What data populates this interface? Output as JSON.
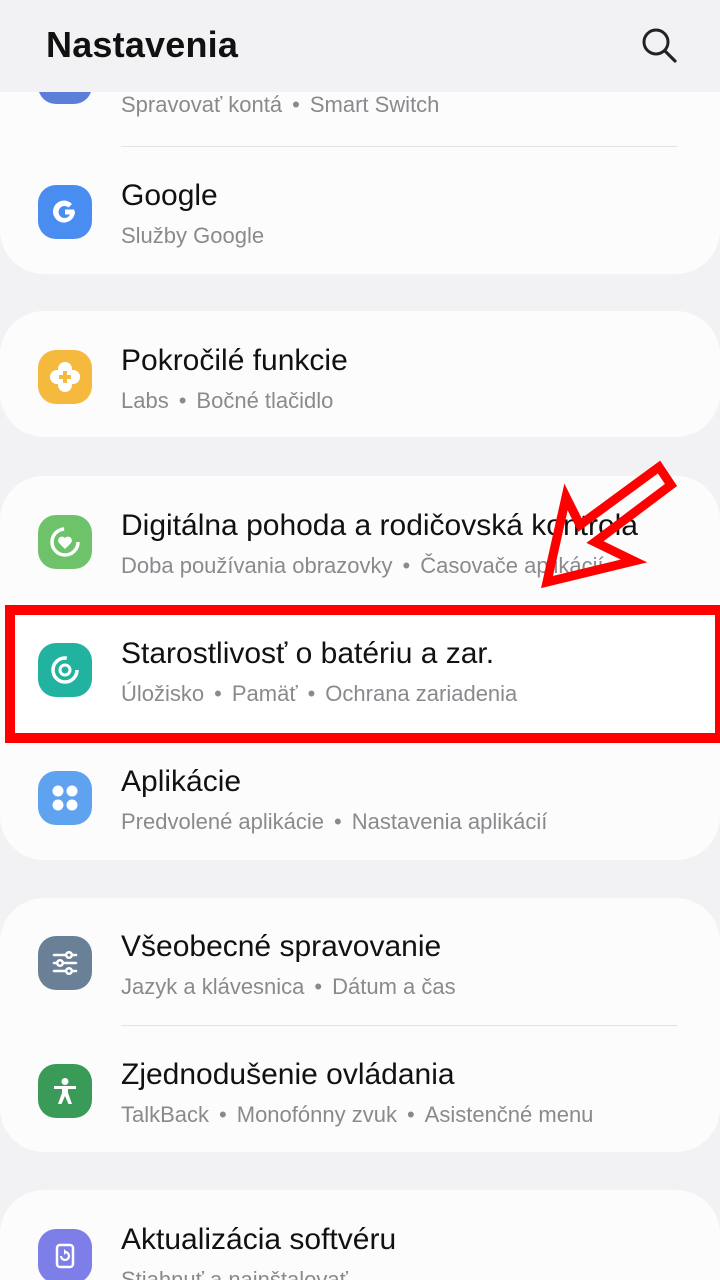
{
  "header": {
    "title": "Nastavenia",
    "search_icon": "search-icon"
  },
  "top_partial": {
    "sub": [
      "Spravovať kontá",
      "Smart Switch"
    ]
  },
  "items": {
    "google": {
      "title": "Google",
      "sub": [
        "Služby Google"
      ],
      "color": "#4a8df0",
      "icon": "google-icon"
    },
    "advanced": {
      "title": "Pokročilé funkcie",
      "sub": [
        "Labs",
        "Bočné tlačidlo"
      ],
      "color": "#f5b93d",
      "icon": "puzzle-icon"
    },
    "wellbeing": {
      "title": "Digitálna pohoda a rodičovská kontrola",
      "sub": [
        "Doba používania obrazovky",
        "Časovače aplikácií"
      ],
      "color": "#6ec36a",
      "icon": "wellbeing-heart-icon"
    },
    "battery": {
      "title": "Starostlivosť o batériu a zar.",
      "sub": [
        "Úložisko",
        "Pamäť",
        "Ochrana zariadenia"
      ],
      "color": "#22b3a0",
      "icon": "device-care-icon"
    },
    "apps": {
      "title": "Aplikácie",
      "sub": [
        "Predvolené aplikácie",
        "Nastavenia aplikácií"
      ],
      "color": "#5ea2f0",
      "icon": "apps-grid-icon"
    },
    "general": {
      "title": "Všeobecné spravovanie",
      "sub": [
        "Jazyk a klávesnica",
        "Dátum a čas"
      ],
      "color": "#6a8096",
      "icon": "sliders-icon"
    },
    "accessibility": {
      "title": "Zjednodušenie ovládania",
      "sub": [
        "TalkBack",
        "Monofónny zvuk",
        "Asistenčné menu"
      ],
      "color": "#3a9a58",
      "icon": "accessibility-person-icon"
    },
    "update": {
      "title": "Aktualizácia softvéru",
      "sub": [
        "Stiahnuť a nainštalovať"
      ],
      "color": "#7d7ee8",
      "icon": "update-icon"
    }
  },
  "annotation": {
    "highlight_color": "#ff0000",
    "arrow_icon": "red-arrow-icon"
  }
}
